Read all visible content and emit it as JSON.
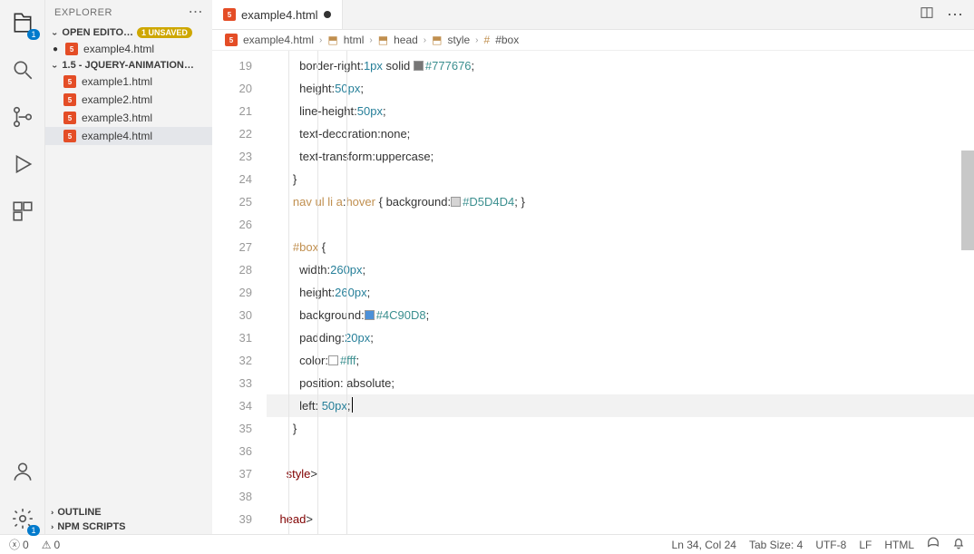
{
  "sidebar": {
    "title": "EXPLORER",
    "openEditors": {
      "label": "OPEN EDITO…",
      "badge": "1 UNSAVED"
    },
    "folder": "1.5 - JQUERY-ANIMATION…",
    "openFiles": [
      {
        "name": "example4.html",
        "dirty": true
      }
    ],
    "files": [
      {
        "name": "example1.html"
      },
      {
        "name": "example2.html"
      },
      {
        "name": "example3.html"
      },
      {
        "name": "example4.html",
        "selected": true
      }
    ],
    "outline": "OUTLINE",
    "npm": "NPM SCRIPTS"
  },
  "tabs": {
    "active": {
      "name": "example4.html",
      "dirty": true
    }
  },
  "breadcrumbs": [
    "example4.html",
    "html",
    "head",
    "style",
    "#box"
  ],
  "code": {
    "startLine": 19,
    "cursor": {
      "line": 34,
      "col": 24
    },
    "lines": [
      {
        "i": "          ",
        "t": [
          [
            "",
            "border-right"
          ],
          [
            "pun",
            ":"
          ],
          [
            "val",
            "1px"
          ],
          [
            "pun",
            " "
          ],
          [
            "",
            "solid"
          ],
          [
            "pun",
            " "
          ],
          [
            "sw",
            "#777676"
          ],
          [
            "hex",
            "#777676"
          ],
          [
            "pun",
            ";"
          ]
        ]
      },
      {
        "i": "          ",
        "t": [
          [
            "",
            "height"
          ],
          [
            "pun",
            ":"
          ],
          [
            "val",
            "50px"
          ],
          [
            "pun",
            ";"
          ]
        ]
      },
      {
        "i": "          ",
        "t": [
          [
            "",
            "line-height"
          ],
          [
            "pun",
            ":"
          ],
          [
            "val",
            "50px"
          ],
          [
            "pun",
            ";"
          ]
        ]
      },
      {
        "i": "          ",
        "t": [
          [
            "",
            "text-decoration"
          ],
          [
            "pun",
            ":"
          ],
          [
            "",
            "none"
          ],
          [
            "pun",
            ";"
          ]
        ]
      },
      {
        "i": "          ",
        "t": [
          [
            "",
            "text-transform"
          ],
          [
            "pun",
            ":"
          ],
          [
            "",
            "uppercase"
          ],
          [
            "pun",
            ";"
          ]
        ]
      },
      {
        "i": "        ",
        "t": [
          [
            "pun",
            "}"
          ]
        ]
      },
      {
        "i": "        ",
        "t": [
          [
            "sel",
            "nav ul li a"
          ],
          [
            "pun",
            ":"
          ],
          [
            "sel",
            "hover"
          ],
          [
            "pun",
            " { "
          ],
          [
            "",
            "background"
          ],
          [
            "pun",
            ":"
          ],
          [
            "sw",
            "#D5D4D4"
          ],
          [
            "hex",
            "#D5D4D4"
          ],
          [
            "pun",
            "; }"
          ]
        ]
      },
      {
        "i": "",
        "t": []
      },
      {
        "i": "        ",
        "t": [
          [
            "sel",
            "#box"
          ],
          [
            "pun",
            " {"
          ]
        ]
      },
      {
        "i": "          ",
        "t": [
          [
            "",
            "width"
          ],
          [
            "pun",
            ":"
          ],
          [
            "val",
            "260px"
          ],
          [
            "pun",
            ";"
          ]
        ]
      },
      {
        "i": "          ",
        "t": [
          [
            "",
            "height"
          ],
          [
            "pun",
            ":"
          ],
          [
            "val",
            "260px"
          ],
          [
            "pun",
            ";"
          ]
        ]
      },
      {
        "i": "          ",
        "t": [
          [
            "",
            "background"
          ],
          [
            "pun",
            ":"
          ],
          [
            "sw",
            "#4C90D8"
          ],
          [
            "hex",
            "#4C90D8"
          ],
          [
            "pun",
            ";"
          ]
        ]
      },
      {
        "i": "          ",
        "t": [
          [
            "",
            "padding"
          ],
          [
            "pun",
            ":"
          ],
          [
            "val",
            "20px"
          ],
          [
            "pun",
            ";"
          ]
        ]
      },
      {
        "i": "          ",
        "t": [
          [
            "",
            "color"
          ],
          [
            "pun",
            ":"
          ],
          [
            "sw",
            "#fff"
          ],
          [
            "hex",
            "#fff"
          ],
          [
            "pun",
            ";"
          ]
        ]
      },
      {
        "i": "          ",
        "t": [
          [
            "",
            "position"
          ],
          [
            "pun",
            ": "
          ],
          [
            "",
            "absolute"
          ],
          [
            "pun",
            ";"
          ]
        ]
      },
      {
        "i": "          ",
        "t": [
          [
            "",
            "left"
          ],
          [
            "pun",
            ": "
          ],
          [
            "val",
            "50px"
          ],
          [
            "pun",
            ";"
          ],
          [
            "cur",
            ""
          ]
        ],
        "hl": true
      },
      {
        "i": "        ",
        "t": [
          [
            "pun",
            "}"
          ]
        ]
      },
      {
        "i": "",
        "t": []
      },
      {
        "i": "      ",
        "t": [
          [
            "pun",
            "</"
          ],
          [
            "tag",
            "style"
          ],
          [
            "pun",
            ">"
          ]
        ]
      },
      {
        "i": "",
        "t": []
      },
      {
        "i": "    ",
        "t": [
          [
            "pun",
            "</"
          ],
          [
            "tag",
            "head"
          ],
          [
            "pun",
            ">"
          ]
        ]
      }
    ]
  },
  "status": {
    "errors": "0",
    "warnings": "0",
    "pos": "Ln 34, Col 24",
    "tab": "Tab Size: 4",
    "enc": "UTF-8",
    "eol": "LF",
    "lang": "HTML"
  },
  "badges": {
    "files": "1",
    "gear": "1"
  }
}
